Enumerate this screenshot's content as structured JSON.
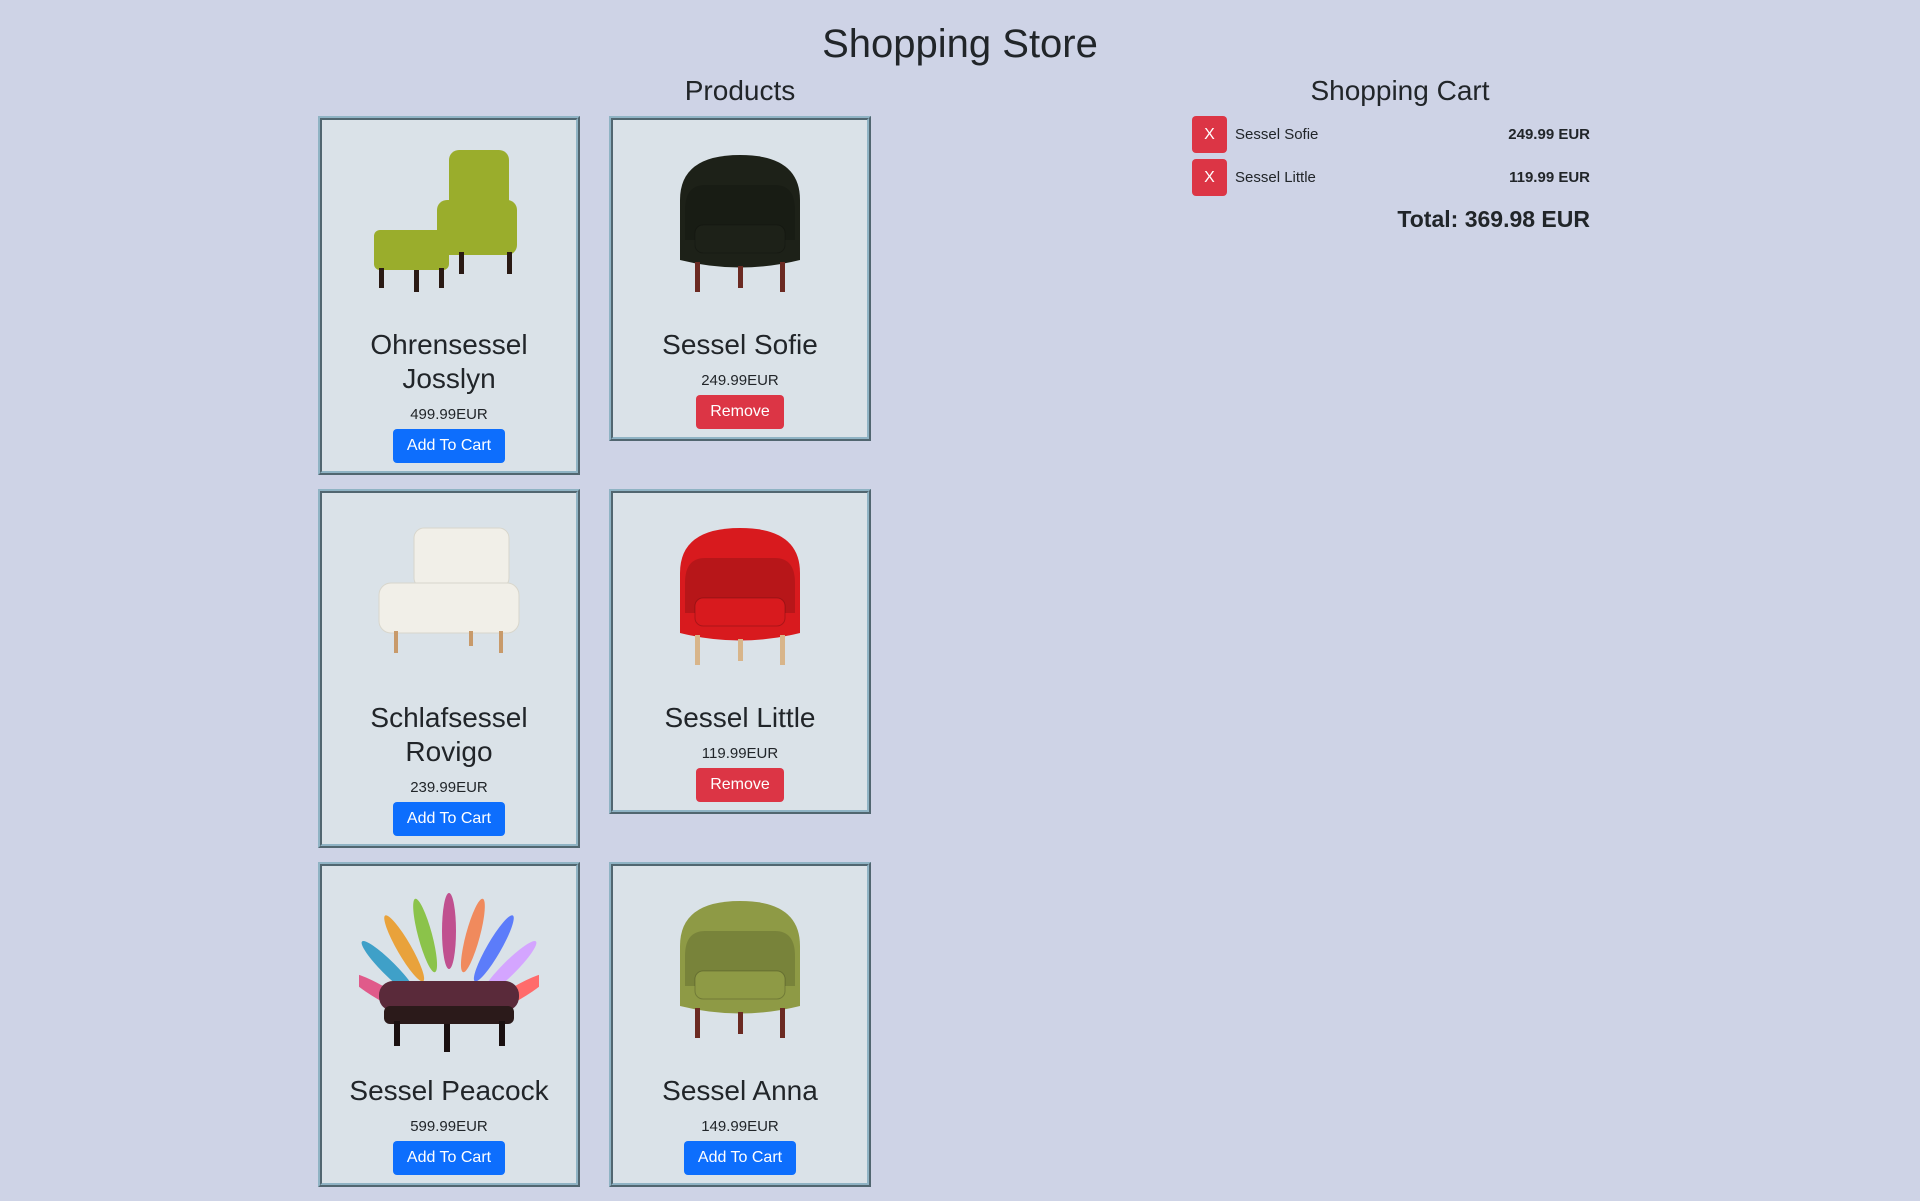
{
  "header": {
    "title": "Shopping Store"
  },
  "products": {
    "heading": "Products",
    "items": [
      {
        "name": "Ohrensessel Josslyn",
        "price": "499.99EUR",
        "button": "Add To Cart",
        "in_cart": false,
        "color": "#9aad2c",
        "image": "wingback-chair-with-ottoman"
      },
      {
        "name": "Sessel Sofie",
        "price": "249.99EUR",
        "button": "Remove",
        "in_cart": true,
        "color": "#1d2118",
        "image": "tufted-armchair"
      },
      {
        "name": "Schlafsessel Rovigo",
        "price": "239.99EUR",
        "button": "Add To Cart",
        "in_cart": false,
        "color": "#f1efe8",
        "image": "sleeper-chair"
      },
      {
        "name": "Sessel Little",
        "price": "119.99EUR",
        "button": "Remove",
        "in_cart": true,
        "color": "#d81a1e",
        "image": "tub-chair"
      },
      {
        "name": "Sessel Peacock",
        "price": "599.99EUR",
        "button": "Add To Cart",
        "in_cart": false,
        "color": "#5a2a3a",
        "image": "peacock-chair"
      },
      {
        "name": "Sessel Anna",
        "price": "149.99EUR",
        "button": "Add To Cart",
        "in_cart": false,
        "color": "#8e9a45",
        "image": "tub-chair"
      }
    ]
  },
  "cart": {
    "heading": "Shopping Cart",
    "remove_label": "X",
    "items": [
      {
        "name": "Sessel Sofie",
        "price": "249.99 EUR"
      },
      {
        "name": "Sessel Little",
        "price": "119.99 EUR"
      }
    ],
    "total": "Total: 369.98 EUR"
  }
}
